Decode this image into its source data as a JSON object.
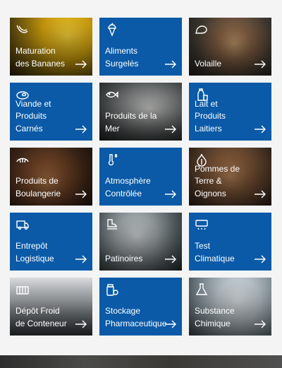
{
  "tiles": [
    {
      "label": "Maturation\ndes Bananes",
      "icon": "banana-icon",
      "style": "photo",
      "bg": "banana"
    },
    {
      "label": "Aliments\nSurgelés",
      "icon": "ice-cream-icon",
      "style": "blue",
      "bg": "blue"
    },
    {
      "label": "Volaille",
      "icon": "poultry-icon",
      "style": "photo",
      "bg": "poultry"
    },
    {
      "label": "Viande et\nProduits\nCarnés",
      "icon": "meat-icon",
      "style": "blue",
      "bg": "blue"
    },
    {
      "label": "Produits de la\nMer",
      "icon": "fish-icon",
      "style": "photo",
      "bg": "fish"
    },
    {
      "label": "Lait et\nProduits\nLaitiers",
      "icon": "milk-icon",
      "style": "blue",
      "bg": "blue"
    },
    {
      "label": "Produits de\nBoulangerie",
      "icon": "croissant-icon",
      "style": "photo",
      "bg": "bakery"
    },
    {
      "label": "Atmosphère\nContrôlée",
      "icon": "thermometer-icon",
      "style": "blue",
      "bg": "blue"
    },
    {
      "label": "Pommes de\nTerre &\nOignons",
      "icon": "onion-icon",
      "style": "photo",
      "bg": "potato"
    },
    {
      "label": "Entrepôt\nLogistique",
      "icon": "truck-icon",
      "style": "blue",
      "bg": "blue"
    },
    {
      "label": "Patinoires",
      "icon": "ice-skate-icon",
      "style": "photo",
      "bg": "skate"
    },
    {
      "label": "Test\nClimatique",
      "icon": "climate-icon",
      "style": "blue",
      "bg": "blue"
    },
    {
      "label": "Dépôt Froid\nde Conteneur",
      "icon": "container-icon",
      "style": "photo",
      "bg": "container"
    },
    {
      "label": "Stockage\nPharmaceutique",
      "icon": "pills-icon",
      "style": "blue",
      "bg": "blue"
    },
    {
      "label": "Substance\nChimique",
      "icon": "lab-icon",
      "style": "photo",
      "bg": "lab"
    }
  ],
  "colors": {
    "tile_blue": "#0a5aa8",
    "text": "#ffffff",
    "page_bg": "#f4f4f4"
  }
}
